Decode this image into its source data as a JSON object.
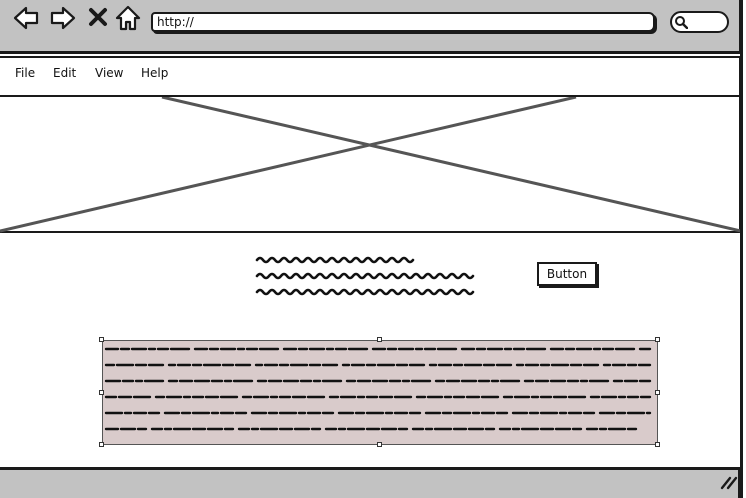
{
  "browser": {
    "url": "http://",
    "icons": [
      "back-arrow-icon",
      "forward-arrow-icon",
      "close-x-icon",
      "home-icon",
      "search-icon",
      "resize-grip-icon"
    ]
  },
  "menu": {
    "items": [
      "File",
      "Edit",
      "View",
      "Help"
    ]
  },
  "content": {
    "button_label": "Button"
  },
  "colors": {
    "chrome": "#c2c2c2",
    "stroke": "#1a1a1a",
    "selection_fill": "#d9cbcb"
  }
}
